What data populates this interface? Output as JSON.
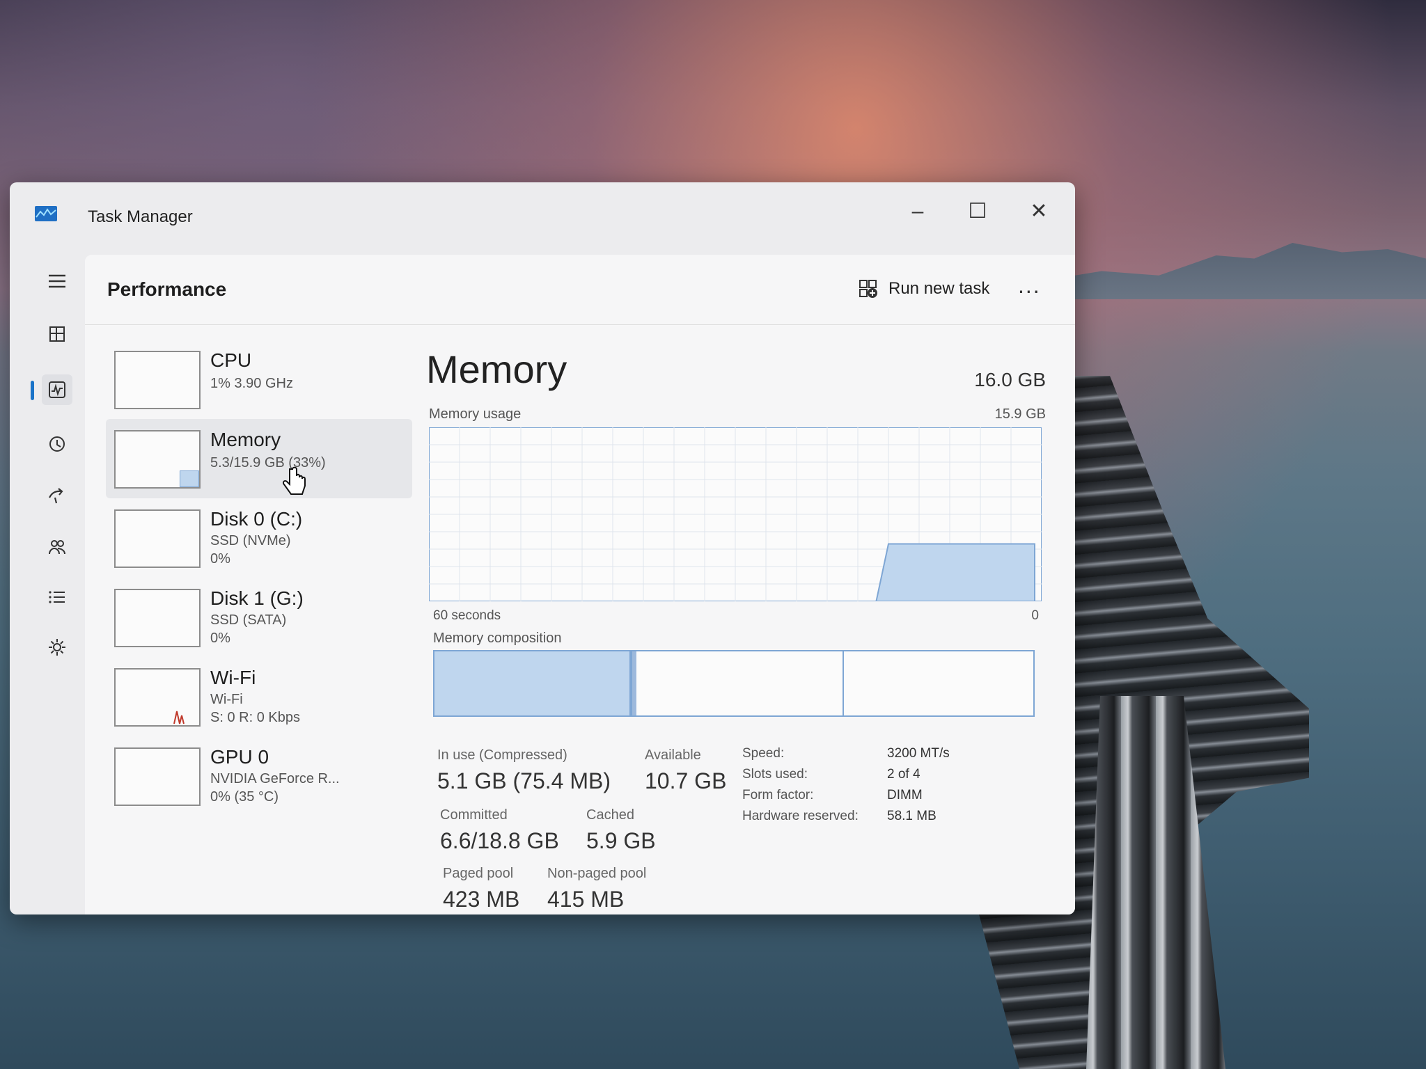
{
  "window": {
    "title": "Task Manager"
  },
  "header": {
    "page_title": "Performance",
    "run_new_task": "Run new task",
    "more": "..."
  },
  "nav_items": [
    "menu-icon",
    "processes-icon",
    "performance-icon",
    "app-history-icon",
    "startup-apps-icon",
    "users-icon",
    "details-icon",
    "services-icon"
  ],
  "resources": [
    {
      "name": "CPU",
      "sub1": "1% 3.90 GHz",
      "sub2": "",
      "sub3": ""
    },
    {
      "name": "Memory",
      "sub1": "5.3/15.9 GB (33%)",
      "sub2": "",
      "sub3": ""
    },
    {
      "name": "Disk 0 (C:)",
      "sub1": "SSD (NVMe)",
      "sub2": "0%",
      "sub3": ""
    },
    {
      "name": "Disk 1 (G:)",
      "sub1": "SSD (SATA)",
      "sub2": "0%",
      "sub3": ""
    },
    {
      "name": "Wi-Fi",
      "sub1": "Wi-Fi",
      "sub2": "S: 0 R: 0 Kbps",
      "sub3": ""
    },
    {
      "name": "GPU 0",
      "sub1": "NVIDIA GeForce R...",
      "sub2": "0% (35 °C)",
      "sub3": ""
    }
  ],
  "memory": {
    "title": "Memory",
    "total": "16.0 GB",
    "usage_label": "Memory usage",
    "usage_max": "15.9 GB",
    "axis_left": "60 seconds",
    "axis_right": "0",
    "composition_label": "Memory composition",
    "usage_fraction": 0.33,
    "stats": {
      "in_use_label": "In use (Compressed)",
      "in_use_value": "5.1 GB (75.4 MB)",
      "available_label": "Available",
      "available_value": "10.7 GB",
      "committed_label": "Committed",
      "committed_value": "6.6/18.8 GB",
      "cached_label": "Cached",
      "cached_value": "5.9 GB",
      "paged_label": "Paged pool",
      "paged_value": "423 MB",
      "nonpaged_label": "Non-paged pool",
      "nonpaged_value": "415 MB"
    },
    "specs": {
      "speed_label": "Speed:",
      "speed_value": "3200 MT/s",
      "slots_label": "Slots used:",
      "slots_value": "2 of 4",
      "form_label": "Form factor:",
      "form_value": "DIMM",
      "hw_label": "Hardware reserved:",
      "hw_value": "58.1 MB"
    }
  },
  "colors": {
    "accent": "#1a73c8",
    "graph_fill": "#bfd6ee",
    "graph_line": "#7ea6d4"
  }
}
